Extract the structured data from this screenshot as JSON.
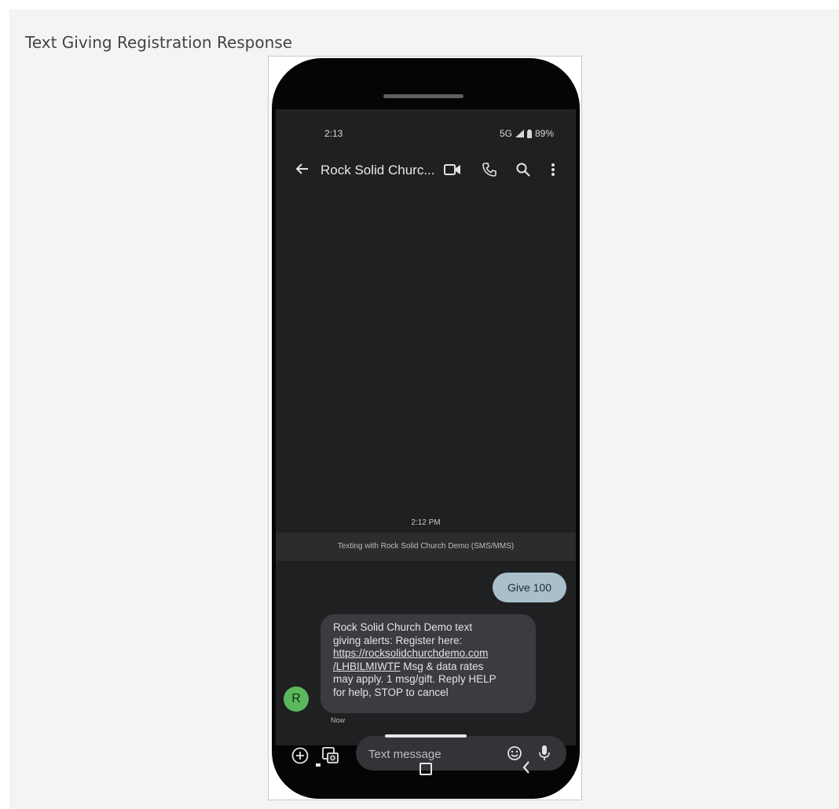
{
  "caption": "Text Giving Registration Response",
  "status_bar": {
    "time": "2:13",
    "network": "5G",
    "battery": "89%"
  },
  "app_bar": {
    "title": "Rock Solid Churc..."
  },
  "conversation": {
    "timestamp": "2:12 PM",
    "banner": "Texting with Rock Solid Church Demo (SMS/MMS)",
    "sent_message": "Give 100",
    "received_lines": [
      "Rock Solid Church Demo text",
      "giving alerts: Register here:",
      "https://rocksolidchurchdemo.com",
      "/LHBILMIWTF",
      "Msg & data rates",
      "may apply. 1 msg/gift. Reply HELP",
      "for help, STOP to cancel"
    ],
    "received_time": "Now",
    "avatar_letter": "R"
  },
  "composer": {
    "placeholder": "Text message"
  },
  "colors": {
    "screen_bg": "#1f2022",
    "sent_bubble": "#a9bfcb",
    "received_bubble": "#3a3c3f",
    "avatar": "#5cb85c"
  },
  "icons": [
    "back-arrow-icon",
    "video-call-icon",
    "phone-icon",
    "search-icon",
    "more-vert-icon",
    "add-icon",
    "gallery-icon",
    "emoji-icon",
    "mic-icon",
    "signal-icon",
    "battery-icon"
  ]
}
